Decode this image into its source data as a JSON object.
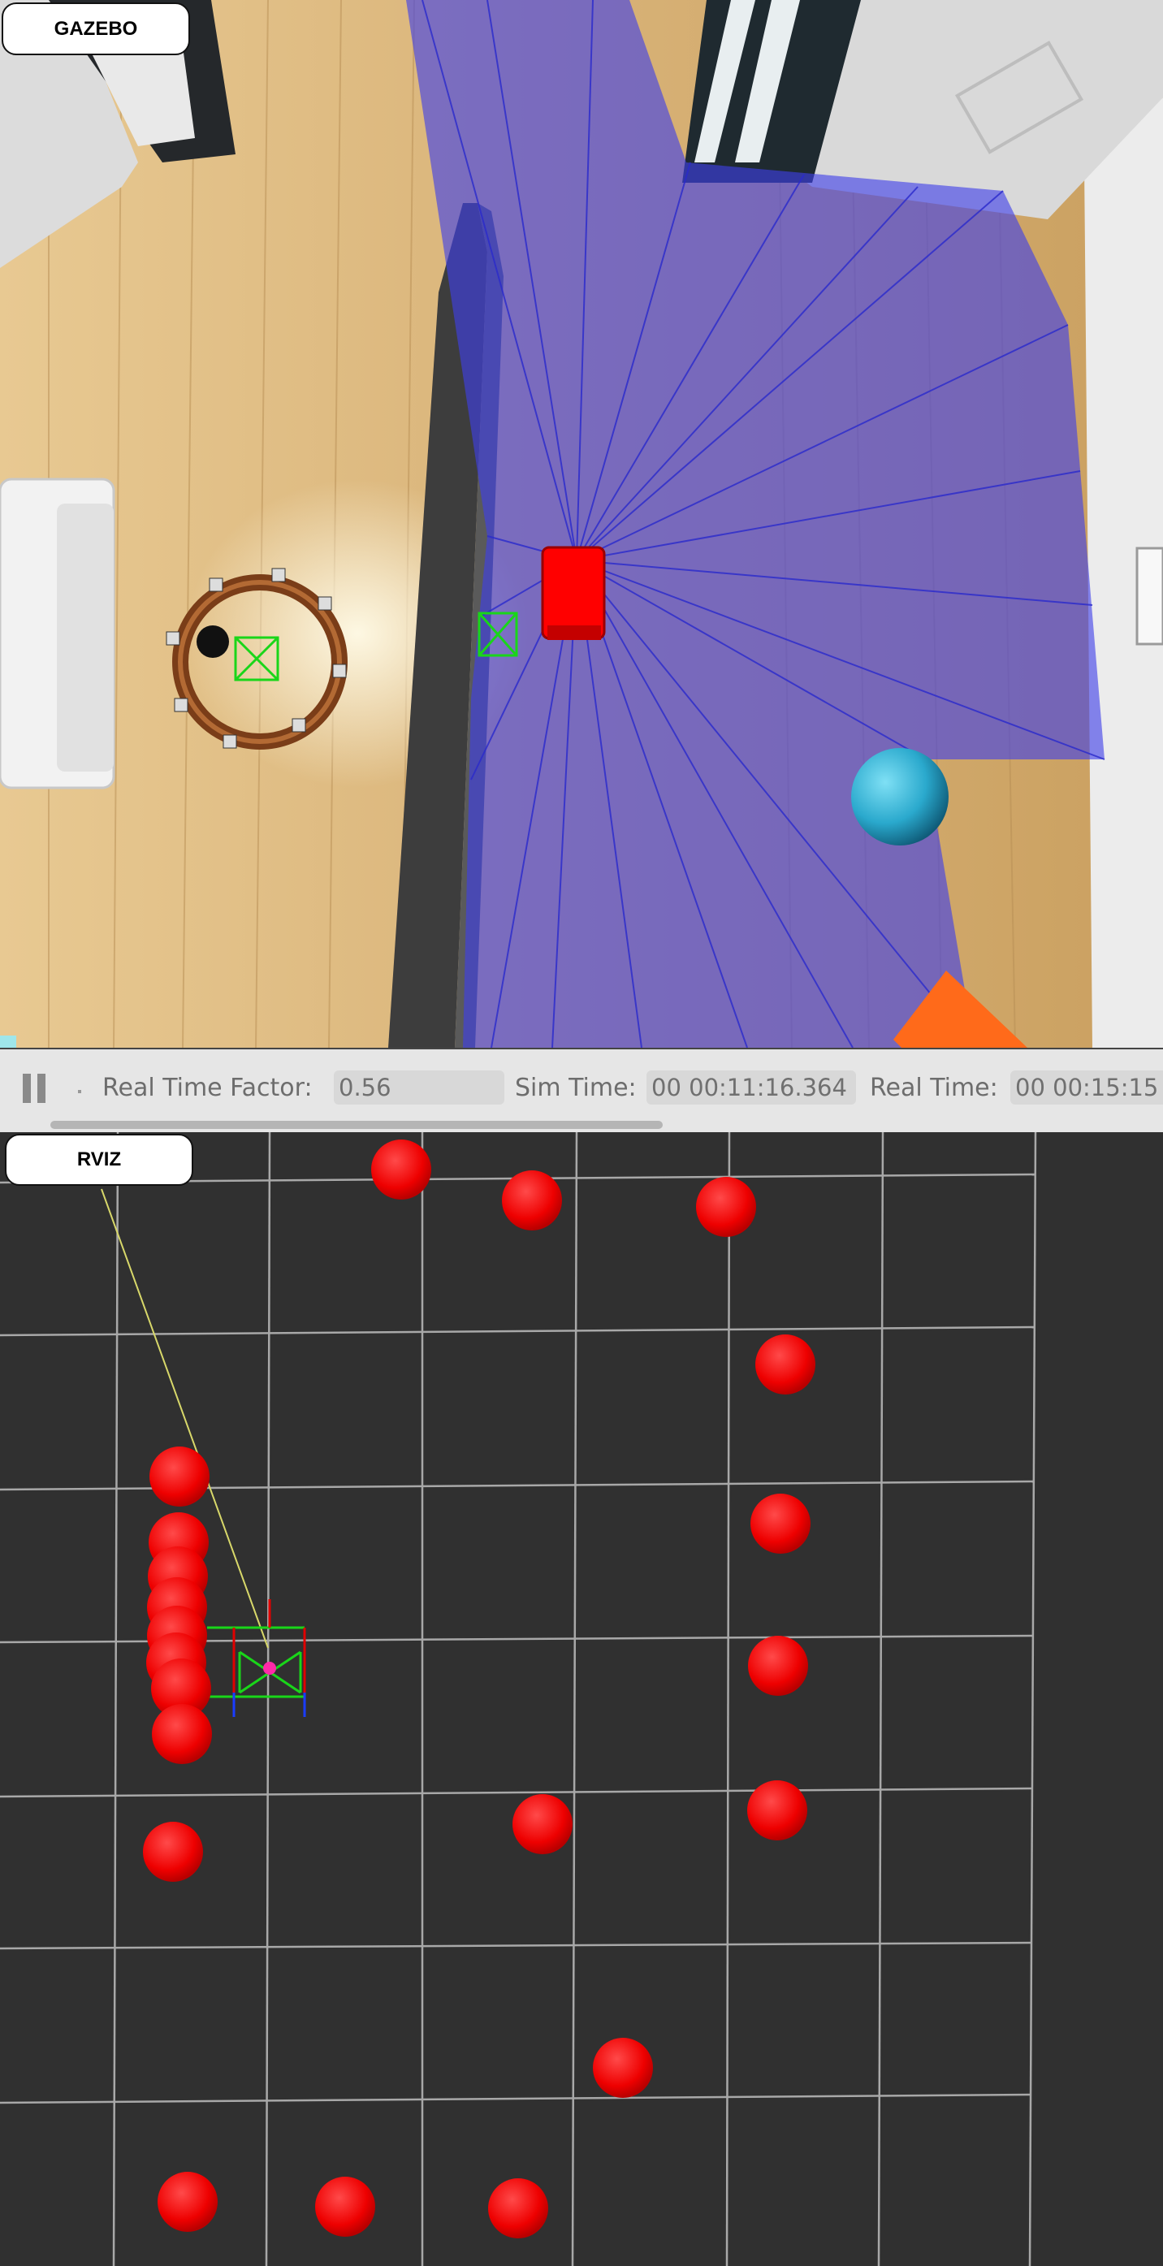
{
  "gazebo": {
    "label": "GAZEBO",
    "toolbar": {
      "real_time_factor_label": "Real Time Factor:",
      "real_time_factor_value": "0.56",
      "sim_time_label": "Sim Time:",
      "sim_time_value": "00 00:11:16.364",
      "real_time_label": "Real Time:",
      "real_time_value": "00 00:15:15"
    },
    "scene": {
      "icons": [
        "robot-icon",
        "laser-scan-icon",
        "ball-icon",
        "cone-icon",
        "table-icon"
      ]
    }
  },
  "rviz": {
    "label": "RVIZ",
    "marker_color": "#ff0000",
    "grid_color": "#a8a8a8",
    "background": "#303030"
  },
  "colors": {
    "laser": "#4a4ae0",
    "robot": "#ff0000",
    "floor": "#dcb37a",
    "ball": "#2ab0d4",
    "toolbar_bg": "#e6e6e6"
  }
}
